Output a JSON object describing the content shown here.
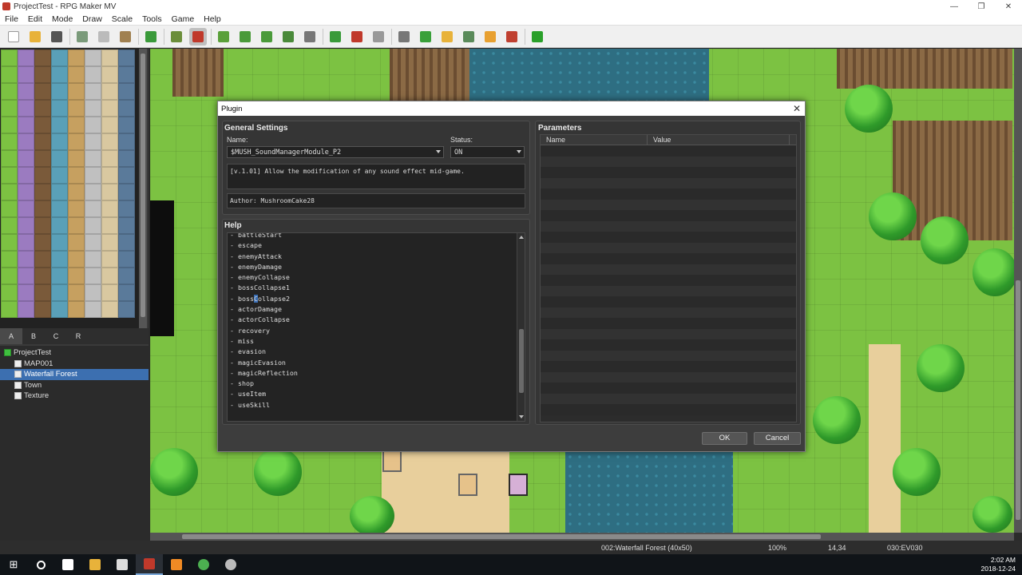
{
  "window": {
    "title": "ProjectTest - RPG Maker MV",
    "controls": [
      "—",
      "❐",
      "✕"
    ]
  },
  "menu": [
    "File",
    "Edit",
    "Mode",
    "Draw",
    "Scale",
    "Tools",
    "Game",
    "Help"
  ],
  "toolbar": {
    "icons": [
      "new-project-icon",
      "open-project-icon",
      "save-project-icon",
      "sep",
      "cut-icon",
      "copy-icon",
      "paste-icon",
      "sep",
      "undo-icon",
      "sep",
      "map-mode-icon",
      "event-mode-icon",
      "sep",
      "pencil-icon",
      "rectangle-icon",
      "ellipse-icon",
      "fill-icon",
      "shadow-pen-icon",
      "sep",
      "zoom-in-icon",
      "zoom-out-icon",
      "actual-size-icon",
      "sep",
      "database-icon",
      "plugin-manager-icon",
      "sound-test-icon",
      "event-searcher-icon",
      "resource-manager-icon",
      "character-generator-icon",
      "sep",
      "playtest-icon"
    ],
    "active": [
      "event-mode-icon"
    ]
  },
  "tileset_tabs": [
    "A",
    "B",
    "C",
    "R"
  ],
  "map_tree": [
    {
      "label": "ProjectTest",
      "level": 0,
      "type": "project"
    },
    {
      "label": "MAP001",
      "level": 1,
      "type": "map"
    },
    {
      "label": "Waterfall Forest",
      "level": 1,
      "type": "map",
      "selected": true
    },
    {
      "label": "Town",
      "level": 1,
      "type": "map"
    },
    {
      "label": "Texture",
      "level": 1,
      "type": "map"
    }
  ],
  "status": {
    "map": "002:Waterfall Forest (40x50)",
    "zoom": "100%",
    "coords": "14,34",
    "event": "030:EV030"
  },
  "taskbar": {
    "start": "⊞",
    "items": [
      "search-icon",
      "task-view-icon",
      "file-explorer-icon",
      "store-icon",
      "rpg-maker-icon",
      "sublime-text-icon",
      "chrome-icon",
      "obs-icon"
    ],
    "time": "2:02 AM",
    "date": "2018-12-24"
  },
  "dialog": {
    "title": "Plugin",
    "general_settings": "General Settings",
    "name_label": "Name:",
    "name_value": "$MUSH_SoundManagerModule_P2",
    "status_label": "Status:",
    "status_value": "ON",
    "description": "[v.1.01] Allow the modification of any sound effect mid-game.",
    "author": "Author: MushroomCake28",
    "help_label": "Help",
    "help_lines": [
      "- battleStart",
      "- escape",
      "- enemyAttack",
      "- enemyDamage",
      "- enemyCollapse",
      "- bossCollapse1",
      "- bossCollapse2",
      "- actorDamage",
      "- actorCollapse",
      "- recovery",
      "- miss",
      "- evasion",
      "- magicEvasion",
      "- magicReflection",
      "- shop",
      "- useItem",
      "- useSkill"
    ],
    "parameters_label": "Parameters",
    "param_col_name": "Name",
    "param_col_value": "Value",
    "ok": "OK",
    "cancel": "Cancel"
  },
  "colors": {
    "accent": "#3c6fb0",
    "dialog_bg": "#3d3d3d",
    "grass": "#7cc242",
    "water": "#2e6e82"
  }
}
